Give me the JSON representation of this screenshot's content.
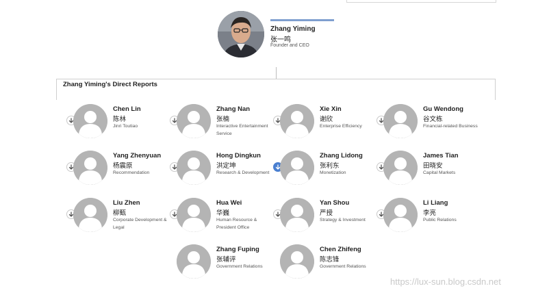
{
  "ceo": {
    "name": "Zhang Yiming",
    "name_cn": "张一鸣",
    "title": "Founder and CEO"
  },
  "section": {
    "title": "Zhang Yiming's Direct Reports"
  },
  "reports": [
    {
      "name": "Chen Lin",
      "name_cn": "陈林",
      "title": "Jinri Toutiao",
      "active": false
    },
    {
      "name": "Zhang Nan",
      "name_cn": "张楠",
      "title": "Interactive Entertainment Service",
      "active": false
    },
    {
      "name": "Xie Xin",
      "name_cn": "谢欣",
      "title": "Enterprise Efficiency",
      "active": false
    },
    {
      "name": "Gu Wendong",
      "name_cn": "谷文栋",
      "title": "Financial-related Business",
      "active": false
    },
    {
      "name": "Yang Zhenyuan",
      "name_cn": "杨震原",
      "title": "Recommendation",
      "active": false
    },
    {
      "name": "Hong Dingkun",
      "name_cn": "洪定坤",
      "title": "Research & Development",
      "active": false
    },
    {
      "name": "Zhang Lidong",
      "name_cn": "张利东",
      "title": "Monetization",
      "active": true
    },
    {
      "name": "James Tian",
      "name_cn": "田晓安",
      "title": "Capital Markets",
      "active": false
    },
    {
      "name": "Liu Zhen",
      "name_cn": "柳甄",
      "title": "Corporate Development & Legal",
      "active": false
    },
    {
      "name": "Hua Wei",
      "name_cn": "华巍",
      "title": "Human Resource & President Office",
      "active": false
    },
    {
      "name": "Yan Shou",
      "name_cn": "严授",
      "title": "Strategy & Investment",
      "active": false
    },
    {
      "name": "Li Liang",
      "name_cn": "李亮",
      "title": "Public Relations",
      "active": false
    },
    {
      "name": "Zhang Fuping",
      "name_cn": "张辅评",
      "title": "Government Relations",
      "active": false
    },
    {
      "name": "Chen Zhifeng",
      "name_cn": "陈志锋",
      "title": "Government Relations",
      "active": false
    }
  ],
  "colors": {
    "accent": "#7f9fcf",
    "active_button": "#4a7fd0",
    "avatar_bg": "#b4b4b4"
  },
  "icons": {
    "expand": "arrow-down-circle-icon",
    "avatar": "person-silhouette-icon"
  },
  "watermark": "https://lux-sun.blog.csdn.net"
}
